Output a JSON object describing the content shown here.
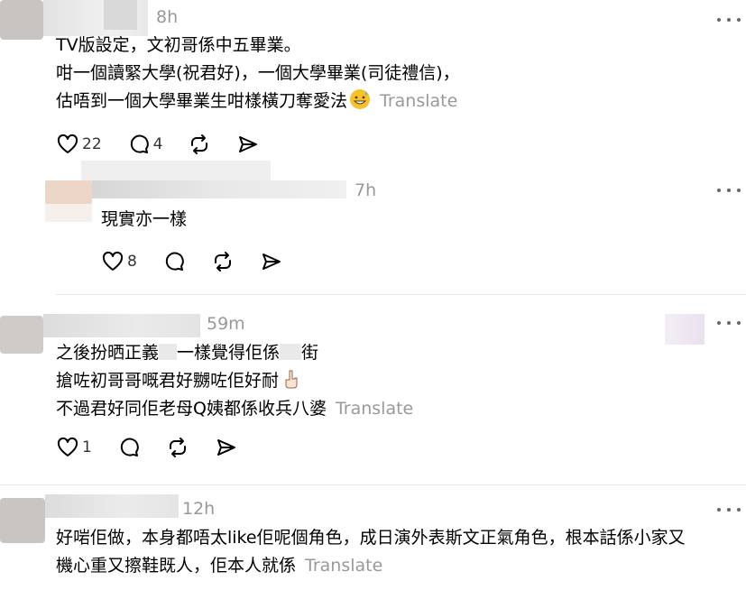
{
  "comments": [
    {
      "time": "8h",
      "lines": [
        "TV版設定，文初哥係中五畢業。",
        "咁一個讀緊大學(祝君好)，一個大學畢業(司徒禮信)，",
        "估唔到一個大學畢業生咁樣橫刀奪愛法"
      ],
      "translate": "Translate",
      "likes": "22",
      "replies": "4"
    },
    {
      "time": "7h",
      "lines": [
        "現實亦一樣"
      ],
      "likes": "8"
    },
    {
      "time": "59m",
      "lines": [
        "之後扮晒正義",
        "一樣覺得佢係",
        "街",
        "搶咗初哥哥嘅君好嬲咗佢好耐",
        "不過君好同佢老母Q姨都係收兵八婆"
      ],
      "translate": "Translate",
      "likes": "1"
    },
    {
      "time": "12h",
      "lines": [
        "好啱佢做，本身都唔太like佢呢個角色，成日演外表斯文正氣角色，根本話係小家又",
        "機心重又擦鞋既人，佢本人就係"
      ],
      "translate": "Translate"
    }
  ],
  "icons": [
    "heart-icon",
    "comment-icon",
    "repost-icon",
    "share-icon",
    "more-icon",
    "grinning-sweat-emoji",
    "hand-gesture-emoji"
  ]
}
